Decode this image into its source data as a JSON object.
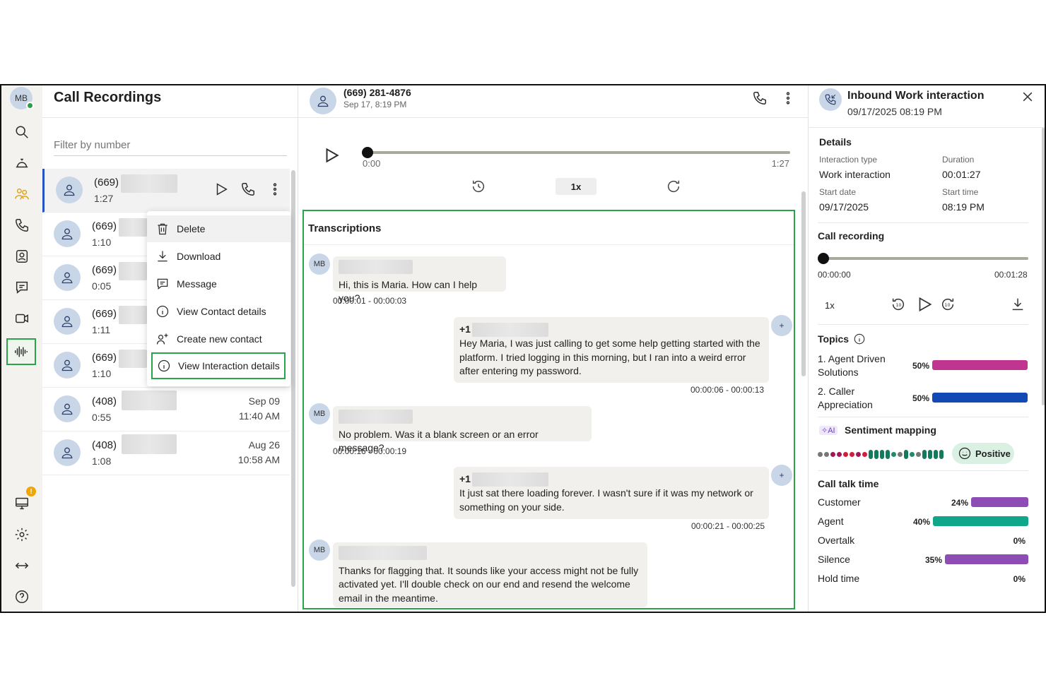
{
  "rail": {
    "avatar_initials": "MB",
    "notification_badge": "!"
  },
  "list": {
    "title": "Call Recordings",
    "filter_placeholder": "Filter by number",
    "rows": [
      {
        "number": "(669)",
        "duration": "1:27",
        "date": "",
        "time": ""
      },
      {
        "number": "(669)",
        "duration": "1:10",
        "date": "",
        "time": ""
      },
      {
        "number": "(669)",
        "duration": "0:05",
        "date": "",
        "time": ""
      },
      {
        "number": "(669)",
        "duration": "1:11",
        "date": "",
        "time": ""
      },
      {
        "number": "(669)",
        "duration": "1:10",
        "date": "",
        "time": ""
      },
      {
        "number": "(408)",
        "duration": "0:55",
        "date": "Sep 09",
        "time": "11:40 AM"
      },
      {
        "number": "(408)",
        "duration": "1:08",
        "date": "Aug 26",
        "time": "10:58 AM"
      }
    ]
  },
  "menu": {
    "items": [
      {
        "label": "Delete",
        "icon": "trash-icon"
      },
      {
        "label": "Download",
        "icon": "download-icon"
      },
      {
        "label": "Message",
        "icon": "message-icon"
      },
      {
        "label": "View Contact details",
        "icon": "info-icon"
      },
      {
        "label": "Create new contact",
        "icon": "add-contact-icon"
      },
      {
        "label": "View Interaction details",
        "icon": "info-icon"
      }
    ]
  },
  "player": {
    "number": "(669) 281-4876",
    "date": "Sep 17, 8:19 PM",
    "current_time": "0:00",
    "total_time": "1:27",
    "speed": "1x"
  },
  "transcriptions": {
    "title": "Transcriptions",
    "messages": [
      {
        "speaker": "MB",
        "text": "Hi, this is Maria. How can I help you?",
        "stamp": "00:00:01 - 00:00:03"
      },
      {
        "speaker": "+1",
        "text": "Hey Maria, I was just calling to get some help getting started with the platform. I tried logging in this morning, but I ran into a weird error after entering my password.",
        "stamp": "00:00:06 - 00:00:13"
      },
      {
        "speaker": "MB",
        "text": "No problem. Was it a blank screen or an error message?",
        "stamp": "00:00:16 - 00:00:19"
      },
      {
        "speaker": "+1",
        "text": "It just sat there loading forever. I wasn't sure if it was my network or something on your side.",
        "stamp": "00:00:21 - 00:00:25"
      },
      {
        "speaker": "MB",
        "text": "Thanks for flagging that. It sounds like your access might not be fully activated yet. I'll double check on our end and resend the welcome email in the meantime.",
        "stamp": ""
      }
    ],
    "plus_avatar": "+"
  },
  "details": {
    "header_title": "Inbound Work interaction",
    "header_sub": "09/17/2025 08:19 PM",
    "section_title": "Details",
    "interaction_type_label": "Interaction type",
    "interaction_type": "Work interaction",
    "duration_label": "Duration",
    "duration": "00:01:27",
    "start_date_label": "Start date",
    "start_date": "09/17/2025",
    "start_time_label": "Start time",
    "start_time": "08:19 PM",
    "recording_title": "Call recording",
    "rec_start": "00:00:00",
    "rec_end": "00:01:28",
    "rec_speed": "1x",
    "topics_title": "Topics",
    "topics": [
      {
        "label_line1": "1. Agent Driven",
        "label_line2": "Solutions",
        "pct": "50%",
        "value": 50,
        "color": "#c0358f"
      },
      {
        "label_line1": "2. Caller",
        "label_line2": "Appreciation",
        "pct": "50%",
        "value": 50,
        "color": "#1249b5"
      }
    ],
    "ai_tag": "AI",
    "sentiment_title": "Sentiment mapping",
    "sentiment_value": "Positive",
    "talk_title": "Call talk time",
    "talk": [
      {
        "label": "Customer",
        "pct": "24%",
        "value": 24,
        "color": "#8e4db5"
      },
      {
        "label": "Agent",
        "pct": "40%",
        "value": 40,
        "color": "#0fa68a"
      },
      {
        "label": "Overtalk",
        "pct": "0%",
        "value": 0,
        "color": "#8e4db5"
      },
      {
        "label": "Silence",
        "pct": "35%",
        "value": 35,
        "color": "#8e4db5"
      },
      {
        "label": "Hold time",
        "pct": "0%",
        "value": 0,
        "color": "#8e4db5"
      }
    ]
  },
  "colors": {
    "accent_green": "#2aa44a",
    "selected_blue": "#2553c4"
  }
}
